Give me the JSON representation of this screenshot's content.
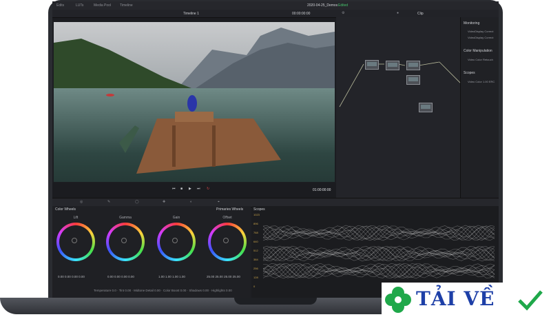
{
  "topbar": {
    "tabs": [
      "Edits",
      "LUTs",
      "Media Pool",
      "Timeline"
    ],
    "timeline_name": "Timeline 1",
    "timecode_in": "00:00:00:00",
    "project_title": "2020-04-25_Demos",
    "status": "Edited",
    "mode": "Clip"
  },
  "viewer": {
    "timecode_out": "01:00:00:00"
  },
  "right_panel": {
    "monitoring": "Monitoring",
    "monitoring_items": [
      "VideoDisplay Correct",
      "VideoDisplay Correct"
    ],
    "color_manipulation": "Color Manipulation",
    "color_manipulation_items": [
      "Video Color Retouch"
    ],
    "scopes": "Scopes",
    "scopes_items": [
      "Video Color 1.00 ERC"
    ]
  },
  "wheels": {
    "panel_title": "Color Wheels",
    "mode_title": "Primaries Wheels",
    "items": [
      {
        "label": "Lift",
        "values": [
          "0.00",
          "0.00",
          "0.00",
          "0.00"
        ]
      },
      {
        "label": "Gamma",
        "values": [
          "0.00",
          "0.00",
          "0.00",
          "0.00"
        ]
      },
      {
        "label": "Gain",
        "values": [
          "1.00",
          "1.00",
          "1.00",
          "1.00"
        ]
      },
      {
        "label": "Offset",
        "values": [
          "25.00",
          "25.00",
          "25.00",
          "25.00"
        ]
      }
    ],
    "bottom": [
      "Temperature",
      "0.0",
      "Tint",
      "0.00",
      "Midtone Detail",
      "0.00",
      "Color Boost",
      "0.00",
      "Shadows",
      "0.00",
      "Highlights",
      "0.00"
    ]
  },
  "scopes": {
    "title": "Scopes",
    "axis": [
      "1023",
      "896",
      "768",
      "640",
      "512",
      "384",
      "256",
      "128",
      "0"
    ]
  },
  "watermark": {
    "text": "TẢI VỀ",
    "accent_green": "#1fa84a",
    "accent_blue": "#1d3fa7"
  }
}
